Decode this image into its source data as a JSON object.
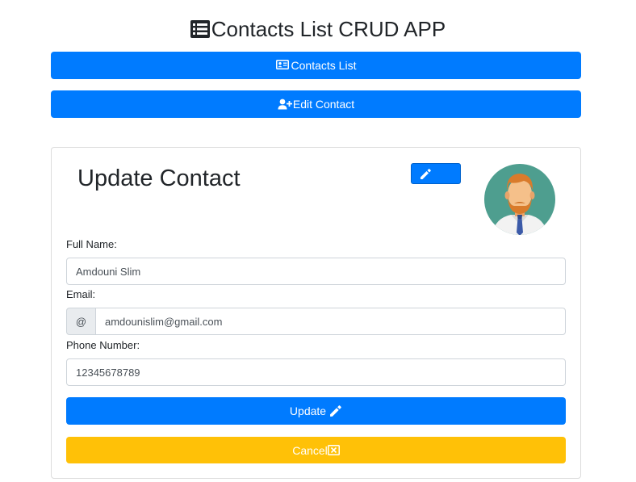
{
  "app": {
    "title": "Contacts List CRUD APP",
    "title_icon": "list-icon"
  },
  "nav": {
    "contacts_list_label": "Contacts List",
    "contacts_list_icon": "address-card-icon",
    "edit_contact_label": "Edit Contact",
    "edit_contact_icon": "user-plus-icon"
  },
  "card": {
    "title": "Update Contact",
    "edit_icon": "pencil-icon",
    "avatar_icon": "bearded-man-avatar"
  },
  "form": {
    "full_name_label": "Full Name:",
    "full_name_value": "Amdouni Slim",
    "email_label": "Email:",
    "email_prefix": "@",
    "email_value": "amdounislim@gmail.com",
    "phone_label": "Phone Number:",
    "phone_value": "12345678789",
    "update_label": "Update",
    "cancel_label": "Cancel"
  },
  "colors": {
    "primary": "#007bff",
    "warning": "#ffc107",
    "avatar_bg": "#4e9e8f"
  }
}
